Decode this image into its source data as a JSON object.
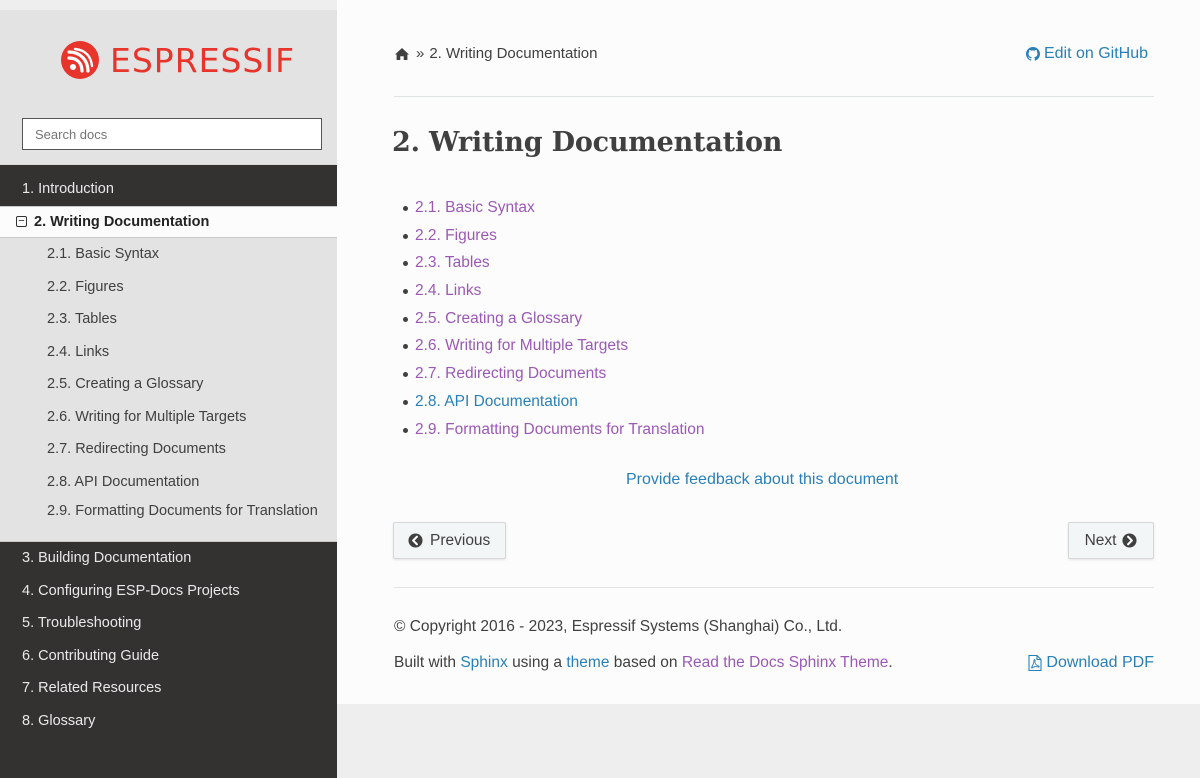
{
  "brand": {
    "name": "ESPRESSIF",
    "color": "#e7352c"
  },
  "search": {
    "placeholder": "Search docs"
  },
  "nav": {
    "before": [
      {
        "label": "1. Introduction"
      }
    ],
    "current": {
      "label": "2. Writing Documentation",
      "toggle_icon": "minus-square-icon"
    },
    "children": [
      {
        "label": "2.1. Basic Syntax"
      },
      {
        "label": "2.2. Figures"
      },
      {
        "label": "2.3. Tables"
      },
      {
        "label": "2.4. Links"
      },
      {
        "label": "2.5. Creating a Glossary"
      },
      {
        "label": "2.6. Writing for Multiple Targets"
      },
      {
        "label": "2.7. Redirecting Documents"
      },
      {
        "label": "2.8. API Documentation"
      },
      {
        "label": "2.9. Formatting Documents for Translation"
      }
    ],
    "after": [
      {
        "label": "3. Building Documentation"
      },
      {
        "label": "4. Configuring ESP-Docs Projects"
      },
      {
        "label": "5. Troubleshooting"
      },
      {
        "label": "6. Contributing Guide"
      },
      {
        "label": "7. Related Resources"
      },
      {
        "label": "8. Glossary"
      }
    ]
  },
  "breadcrumb": {
    "icon": "home-icon",
    "separator": "»",
    "current": "2. Writing Documentation"
  },
  "edit_link": {
    "icon": "github-icon",
    "label": "Edit on GitHub"
  },
  "page": {
    "title": "2. Writing Documentation",
    "toc": [
      {
        "label": "2.1. Basic Syntax"
      },
      {
        "label": "2.2. Figures"
      },
      {
        "label": "2.3. Tables"
      },
      {
        "label": "2.4. Links"
      },
      {
        "label": "2.5. Creating a Glossary"
      },
      {
        "label": "2.6. Writing for Multiple Targets"
      },
      {
        "label": "2.7. Redirecting Documents"
      },
      {
        "label": "2.8. API Documentation"
      },
      {
        "label": "2.9. Formatting Documents for Translation"
      }
    ],
    "feedback": "Provide feedback about this document"
  },
  "pager": {
    "previous": "Previous",
    "next": "Next"
  },
  "footer": {
    "copyright": "© Copyright 2016 - 2023, Espressif Systems (Shanghai) Co., Ltd.",
    "built_with_prefix": "Built with",
    "sphinx": "Sphinx",
    "using_a": "using a",
    "theme": "theme",
    "based_on": "based on",
    "rtd_theme": "Read the Docs Sphinx Theme",
    "period": ".",
    "download_pdf": "Download PDF"
  },
  "colors": {
    "sidebar_bg": "#343131",
    "link_blue": "#2980b9",
    "link_visited": "#9b59b6",
    "text": "#404040"
  }
}
